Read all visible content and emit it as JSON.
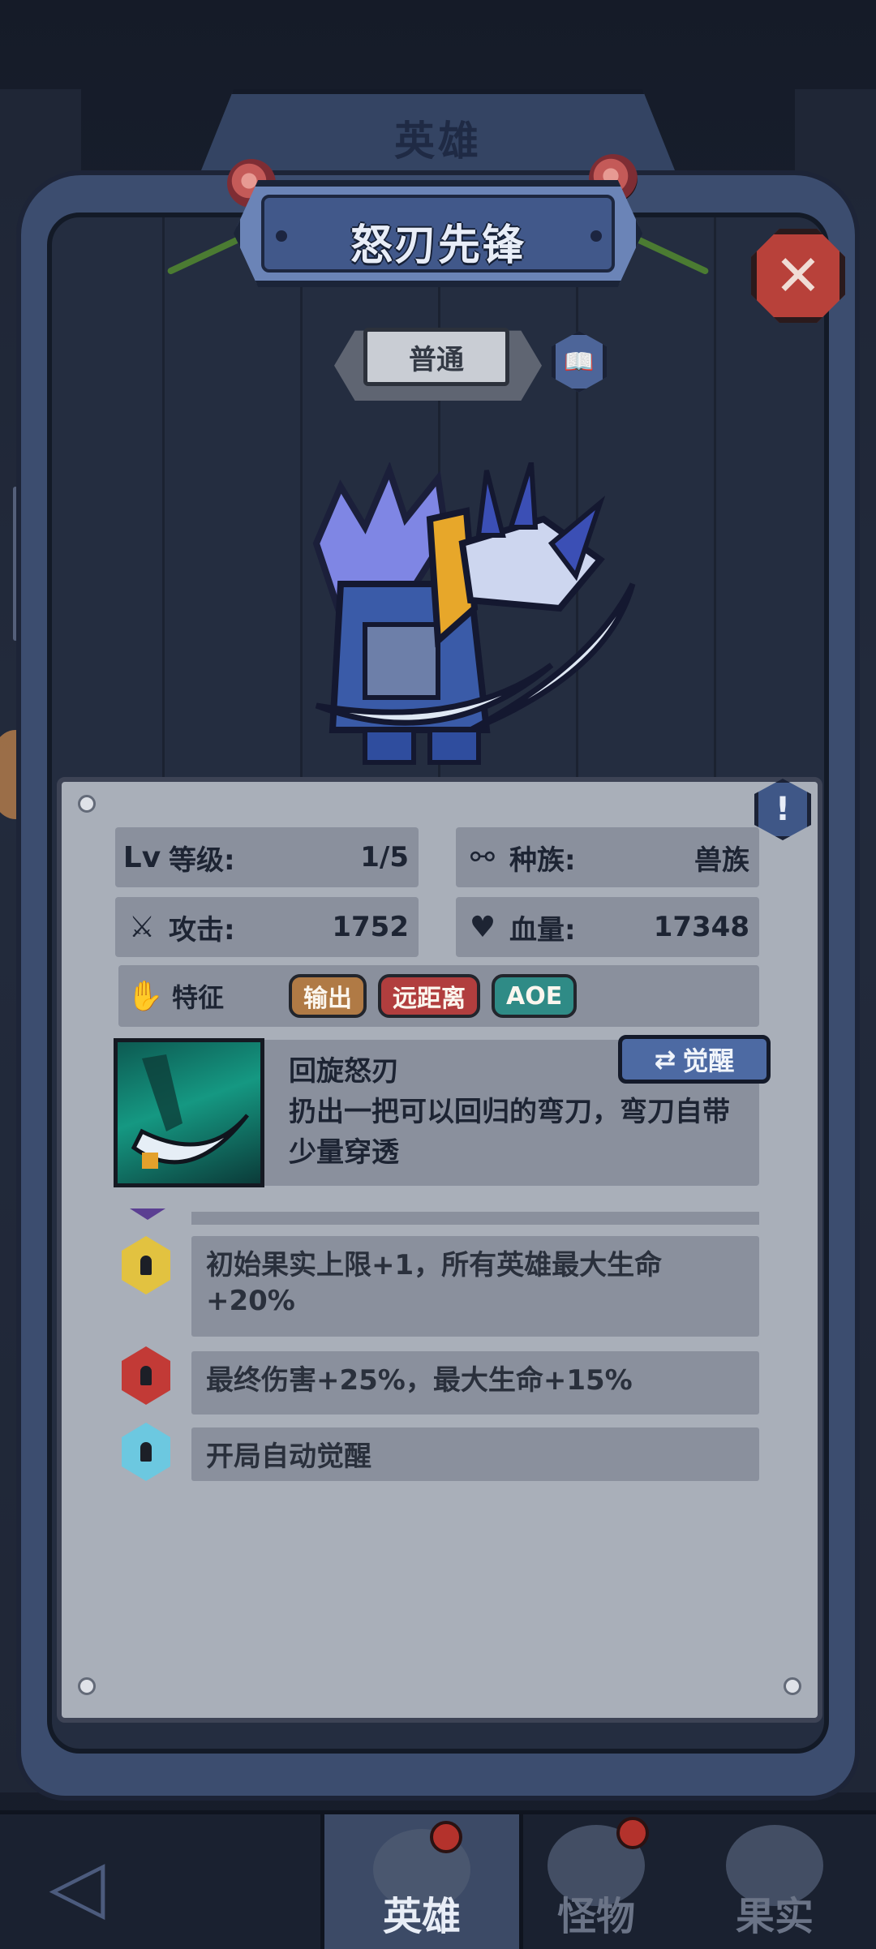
{
  "header": {
    "tab_label": "英雄",
    "hero_name": "怒刃先锋",
    "rarity": "普通"
  },
  "stats": {
    "level_label": "等级:",
    "level_value": "1/5",
    "race_label": "种族:",
    "race_value": "兽族",
    "attack_label": "攻击:",
    "attack_value": "1752",
    "hp_label": "血量:",
    "hp_value": "17348"
  },
  "traits": {
    "label": "特征",
    "tags": [
      {
        "text": "输出",
        "color": "#b07a45"
      },
      {
        "text": "远距离",
        "color": "#b13e3e"
      },
      {
        "text": "AOE",
        "color": "#2f8b86"
      }
    ]
  },
  "skill": {
    "name": "回旋怒刃",
    "description": "扔出一把可以回归的弯刀，弯刀自带少量穿透",
    "awaken_label": "觉醒"
  },
  "bonuses": [
    {
      "text": "初始果实上限+1，所有英雄最大生命+20%",
      "color": "#e2c240"
    },
    {
      "text": "最终伤害+25%，最大生命+15%",
      "color": "#c23a36"
    },
    {
      "text": "开局自动觉醒",
      "color": "#6cc8e0"
    }
  ],
  "info_badge": "!",
  "close_symbol": "✕",
  "bottom_nav": [
    {
      "label": "英雄",
      "active": true
    },
    {
      "label": "怪物",
      "active": false
    },
    {
      "label": "果实",
      "active": false
    }
  ],
  "colors": {
    "frame": "#3c4d6f",
    "card": "#a9afb9",
    "stat_box": "#8a909d",
    "close": "#b8413a",
    "awaken": "#4d6aa3"
  }
}
